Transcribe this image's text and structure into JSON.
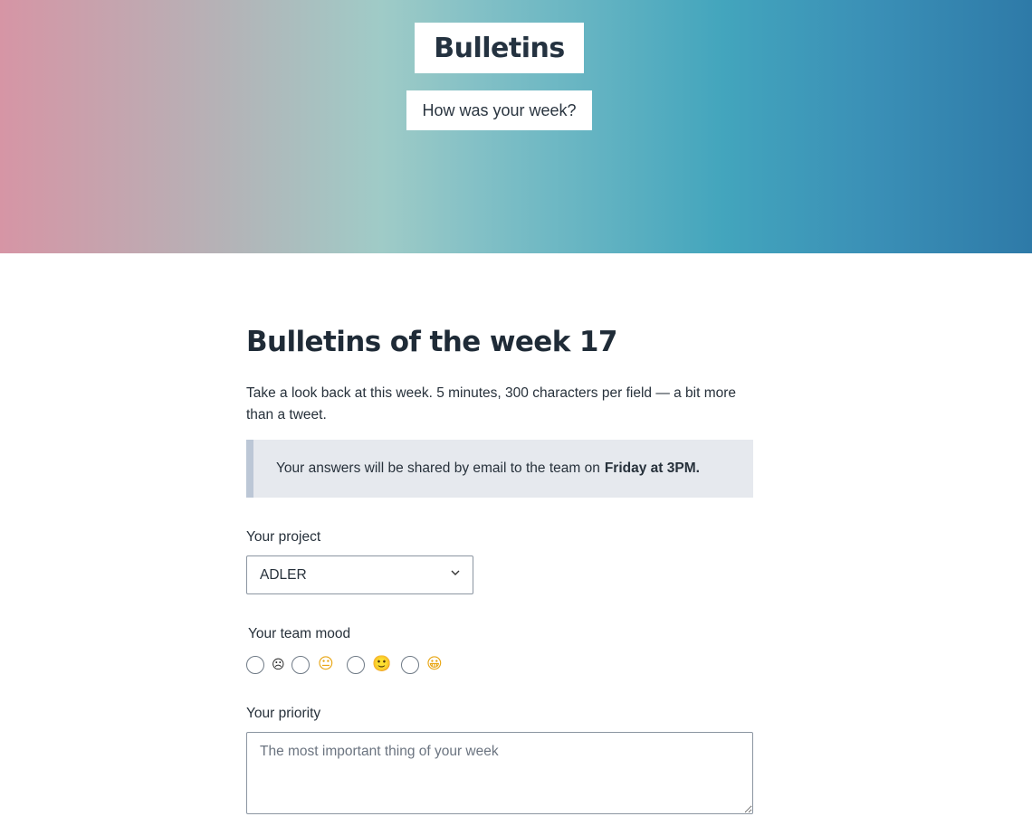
{
  "hero": {
    "title": "Bulletins",
    "subtitle": "How was your week?"
  },
  "main": {
    "title": "Bulletins of the week 17",
    "intro": "Take a look back at this week. 5 minutes, 300 characters per field — a bit more than a tweet.",
    "notice": {
      "text": "Your answers will be shared by email to the team on",
      "emphasis": "Friday at 3PM."
    },
    "project": {
      "label": "Your project",
      "selected": "ADLER"
    },
    "mood": {
      "label": "Your team mood",
      "options": [
        {
          "icon": "sad-face-icon",
          "glyph": "☹"
        },
        {
          "icon": "neutral-face-icon",
          "glyph": "😐"
        },
        {
          "icon": "slight-smile-face-icon",
          "glyph": "🙂"
        },
        {
          "icon": "grinning-face-icon",
          "glyph": "😀"
        }
      ]
    },
    "priority": {
      "label": "Your priority",
      "placeholder": "The most important thing of your week"
    }
  },
  "colors": {
    "hero_gradient": [
      "#d695a5",
      "#9fcbc7",
      "#43a5bd",
      "#2e7aa8"
    ],
    "notice_bg": "#e6e9ee",
    "notice_border": "#bcc7d6"
  }
}
